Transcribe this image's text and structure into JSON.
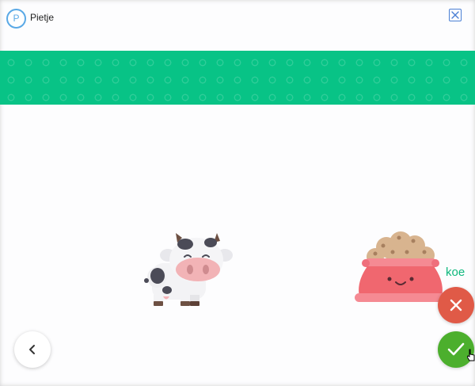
{
  "header": {
    "avatar_letter": "P",
    "username": "Pietje"
  },
  "theme": {
    "accent": "#08c386",
    "wrong_color": "#e05a47",
    "right_color": "#4caf2d",
    "avatar_color": "#5aa9e6"
  },
  "scene": {
    "animal_image": "cow",
    "food_image": "food-bowl",
    "word": "koe"
  },
  "icons": {
    "close": "close-icon",
    "back": "chevron-left-icon",
    "wrong": "cross-icon",
    "right": "check-icon"
  }
}
